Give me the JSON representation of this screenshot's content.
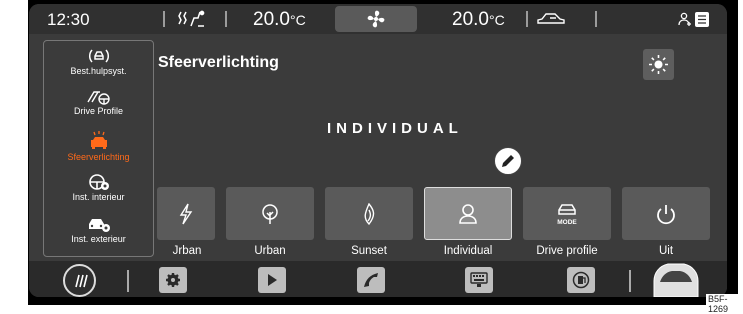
{
  "status": {
    "time": "12:30",
    "temp_left_value": "20.0",
    "temp_left_unit": "°C",
    "temp_right_value": "20.0",
    "temp_right_unit": "°C",
    "icons": [
      "seat-heating-icon",
      "fan-icon",
      "car-air-icon",
      "person-icon",
      "list-icon"
    ]
  },
  "sidebar": {
    "items": [
      {
        "label": "Best.hulpsyst.",
        "icon": "assist-car-icon",
        "active": false
      },
      {
        "label": "Drive Profile",
        "icon": "drive-profile-icon",
        "active": false
      },
      {
        "label": "Sfeerverlichting",
        "icon": "ambient-light-icon",
        "active": true
      },
      {
        "label": "Inst. interieur",
        "icon": "interior-settings-icon",
        "active": false
      },
      {
        "label": "Inst. exterieur",
        "icon": "exterior-settings-icon",
        "active": false
      }
    ]
  },
  "main": {
    "title": "Sfeerverlichting",
    "selected_mode": "INDIVIDUAL",
    "tiles": [
      {
        "label": "Jrban",
        "icon": "bolt-icon"
      },
      {
        "label": "Urban",
        "icon": "tree-icon"
      },
      {
        "label": "Sunset",
        "icon": "flame-icon"
      },
      {
        "label": "Individual",
        "icon": "person-icon",
        "selected": true
      },
      {
        "label": "Drive profile",
        "icon": "car-mode-icon",
        "badge": "MODE"
      },
      {
        "label": "Uit",
        "icon": "power-icon"
      }
    ]
  },
  "dock": {
    "items": [
      "menu-icon",
      "settings-icon",
      "play-icon",
      "phone-icon",
      "keyboard-icon",
      "fuel-icon",
      "car-icon"
    ]
  },
  "figure_code": "B5F-1269",
  "colors": {
    "accent": "#ff6a1a",
    "background": "#3b3b3b"
  }
}
